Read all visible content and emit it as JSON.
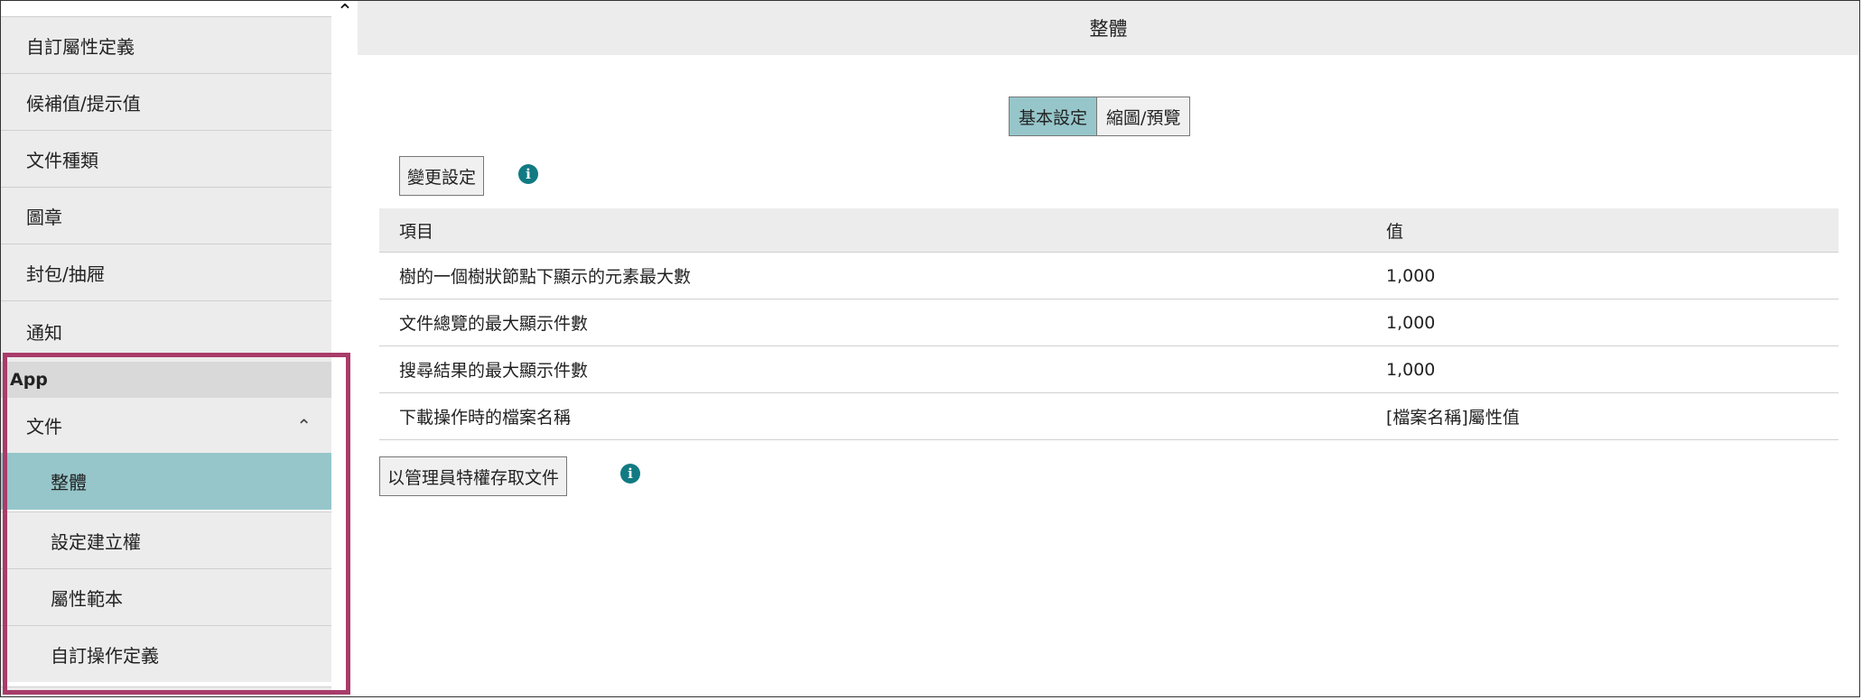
{
  "sidebar": {
    "scroll_up_icon": "chevron-up-icon",
    "items": [
      {
        "label": "自訂屬性定義"
      },
      {
        "label": "候補值/提示值"
      },
      {
        "label": "文件種類"
      },
      {
        "label": "圖章"
      },
      {
        "label": "封包/抽屜"
      },
      {
        "label": "通知"
      }
    ],
    "section_label": "App",
    "group": {
      "label": "文件",
      "expanded_icon": "chevron-up-icon",
      "sub_items": [
        {
          "label": "整體",
          "active": true
        },
        {
          "label": "設定建立權",
          "active": false
        },
        {
          "label": "屬性範本",
          "active": false
        },
        {
          "label": "自訂操作定義",
          "active": false
        }
      ]
    },
    "highlight_color": "#a83c6a",
    "active_color": "#96c6ca"
  },
  "main": {
    "title": "整體",
    "tabs": [
      {
        "label": "基本設定",
        "active": true
      },
      {
        "label": "縮圖/預覽",
        "active": false
      }
    ],
    "change_settings_button": "變更設定",
    "table": {
      "headers": [
        "項目",
        "值"
      ],
      "rows": [
        {
          "item": "樹的一個樹狀節點下顯示的元素最大數",
          "value": "1,000"
        },
        {
          "item": "文件總覽的最大顯示件數",
          "value": "1,000"
        },
        {
          "item": "搜尋結果的最大顯示件數",
          "value": "1,000"
        },
        {
          "item": "下載操作時的檔案名稱",
          "value": "[檔案名稱]屬性值"
        }
      ]
    },
    "admin_access_button": "以管理員特權存取文件",
    "info_icon": "info-icon",
    "info_icon_color": "#117a83"
  }
}
